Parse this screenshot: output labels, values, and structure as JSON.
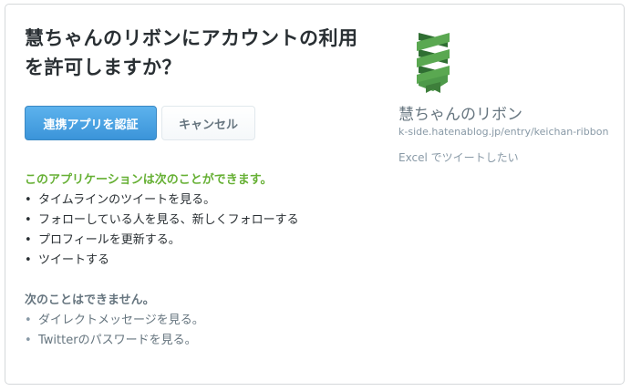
{
  "authorize": {
    "title": "慧ちゃんのリボンにアカウントの利用を許可しますか？",
    "authorize_button": "連携アプリを認証",
    "cancel_button": "キャンセル"
  },
  "permissions": {
    "heading": "このアプリケーションは次のことができます。",
    "items": [
      "タイムラインのツイートを見る。",
      "フォローしている人を見る、新しくフォローする",
      "プロフィールを更新する。",
      "ツイートする"
    ]
  },
  "restrictions": {
    "heading": "次のことはできません。",
    "items": [
      "ダイレクトメッセージを見る。",
      "Twitterのパスワードを見る。"
    ]
  },
  "app": {
    "logo_icon": "green-ribbon-logo",
    "name": "慧ちゃんのリボン",
    "url": "k-side.hatenablog.jp/entry/keichan-ribbon",
    "description": "Excel でツイートしたい"
  },
  "colors": {
    "primary_button": "#3b94d9",
    "permission_heading": "#66b034",
    "logo_green": "#4e9a4a"
  }
}
